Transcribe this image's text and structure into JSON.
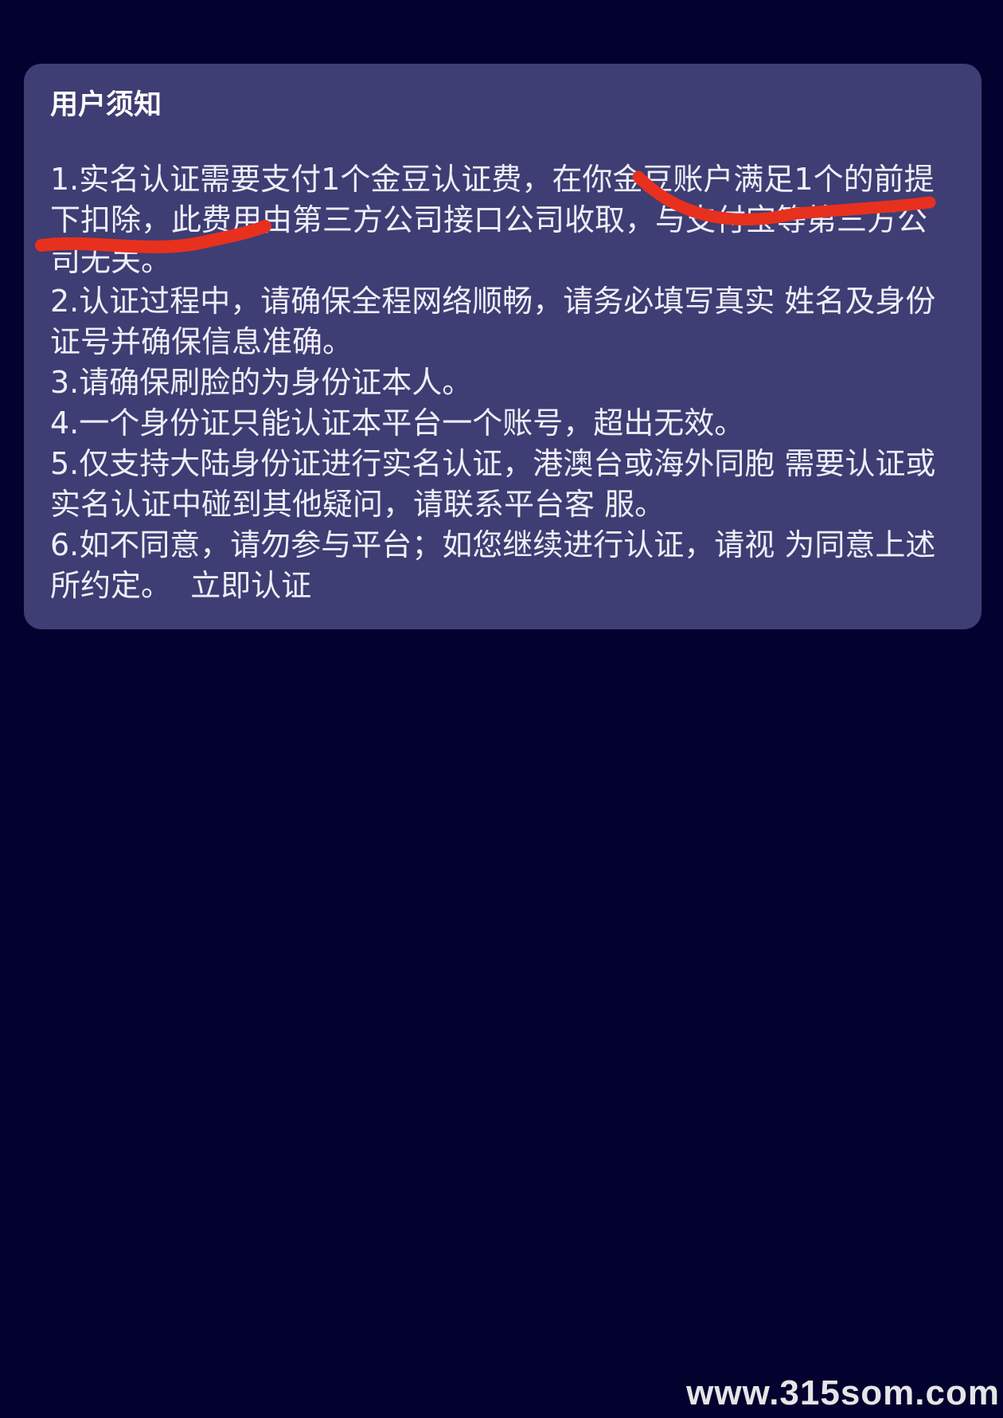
{
  "notice": {
    "title": "用户须知",
    "items": [
      "1.实名认证需要支付1个金豆认证费，在你金豆账户满足1个的前提下扣除，此费用由第三方公司接口公司收取，与支付宝等第三方公司无关。",
      "2.认证过程中，请确保全程网络顺畅，请务必填写真实 姓名及身份证号并确保信息准确。",
      "3.请确保刷脸的为身份证本人。",
      "4.一个身份证只能认证本平台一个账号，超出无效。",
      "5.仅支持大陆身份证进行实名认证，港澳台或海外同胞 需要认证或实名认证中碰到其他疑问，请联系平台客 服。",
      "6.如不同意，请勿参与平台；如您继续进行认证，请视 为同意上述所约定。"
    ],
    "verify_link": "立即认证"
  },
  "annotation": {
    "color": "#e8301e"
  },
  "watermark": "www.315som.com"
}
